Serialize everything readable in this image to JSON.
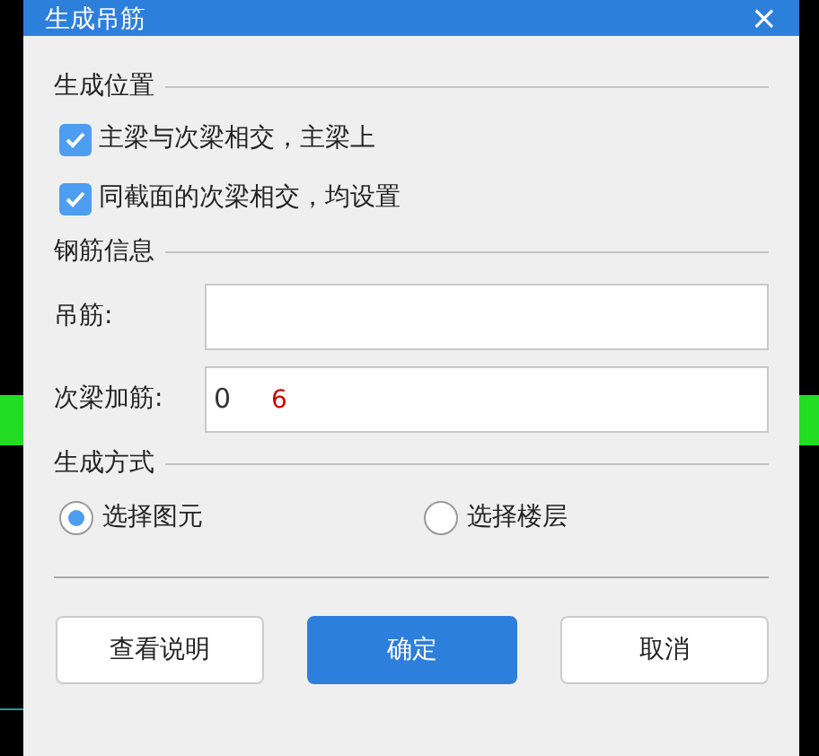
{
  "window": {
    "title": "生成吊筋",
    "close": "×"
  },
  "sections": [
    {
      "heading": "生成位置",
      "items": [
        {
          "kind": "checkbox",
          "label": "主梁与次梁相交，主梁上",
          "checked": true
        },
        {
          "kind": "checkbox",
          "label": "同截面的次梁相交，均设置",
          "checked": true
        }
      ]
    },
    {
      "heading": "钢筋信息",
      "items": [
        {
          "kind": "field",
          "label": "吊筋:",
          "value": ""
        },
        {
          "kind": "field",
          "label": "次梁加筋:",
          "value": "0",
          "overlay": "6"
        }
      ]
    },
    {
      "heading": "生成方式",
      "items": [
        {
          "kind": "radios",
          "options": [
            {
              "label": "选择图元",
              "selected": true
            },
            {
              "label": "选择楼层",
              "selected": false
            }
          ]
        }
      ]
    }
  ],
  "buttons": [
    {
      "label": "查看说明",
      "primary": false
    },
    {
      "label": "确定",
      "primary": true
    },
    {
      "label": "取消",
      "primary": false
    }
  ]
}
